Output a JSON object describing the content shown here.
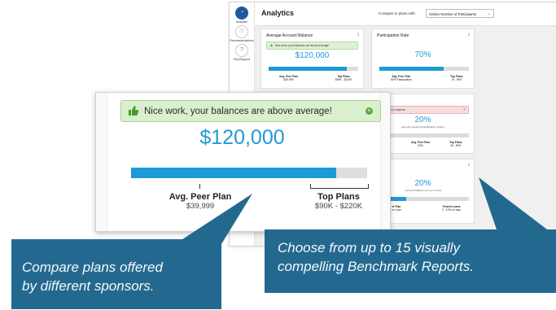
{
  "sidebar": {
    "items": [
      {
        "label": "Analytics",
        "icon": "gauge-icon"
      },
      {
        "label": "Recommendations",
        "icon": "lightbulb-icon"
      },
      {
        "label": "FAQ/Support",
        "icon": "question-icon"
      }
    ]
  },
  "header": {
    "title": "Analytics",
    "compare_label": "Compare to plans with",
    "compare_value": "Similar Number of Participants"
  },
  "cards": {
    "balance": {
      "title": "Average Account Balance",
      "alert": "Nice work, your balances are above average!",
      "value": "$120,000",
      "fill": 0.87,
      "peer_label": "Avg. Peer Plan",
      "peer_value": "$39,999",
      "top_label": "Top Plans",
      "top_value": "$90K - $220K"
    },
    "participation": {
      "title": "Participation Rate",
      "value": "70%",
      "fill": 0.72,
      "peer_label": "Avg. Peer Plan",
      "peer_value": "60% Participation",
      "top_label": "Top Plans",
      "top_value": "76 - 95%"
    },
    "diversification": {
      "alert": "room to improve",
      "value": "20%",
      "sub": "ants are meeting Diversification Criteria",
      "peer_label": "Avg. Peer Plan",
      "peer_value": "30%",
      "top_label": "Top Plans",
      "top_value": "35 - 55%"
    },
    "loans": {
      "value": "20%",
      "sub": "t account balances are out on loan",
      "fill": 0.3,
      "peer_label": "er Plan",
      "peer_value": "on Loan",
      "top_label": "Fewest Loans",
      "top_value": "0 - 10% on loan"
    }
  },
  "callouts": {
    "left_line1": "Compare plans offered",
    "left_line2": "by different sponsors.",
    "right_line1": "Choose from up to 15 visually",
    "right_line2": "compelling Benchmark Reports."
  },
  "colors": {
    "accent": "#1f9ad8",
    "callout": "#23698f",
    "success": "#d9efcd",
    "warning": "#f7dddd",
    "nav_active": "#1d5a9c"
  }
}
